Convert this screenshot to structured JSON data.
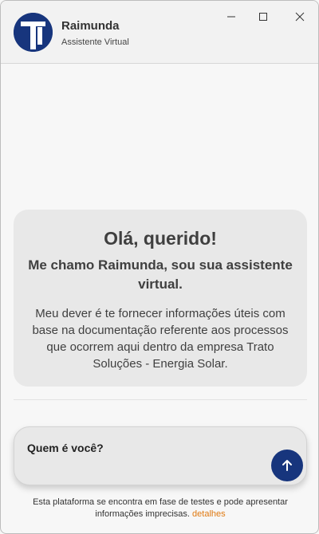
{
  "header": {
    "bot_name": "Raimunda",
    "bot_subtitle": "Assistente Virtual",
    "avatar_icon": "trato-logo-icon",
    "window_controls": [
      "minimize-icon",
      "maximize-icon",
      "close-icon"
    ]
  },
  "welcome": {
    "title": "Olá, querido!",
    "subtitle": "Me chamo Raimunda, sou sua assistente virtual.",
    "body": "Meu dever é te fornecer informações úteis com base na documentação referente aos processos que ocorrem aqui dentro da empresa Trato Soluções - Energia Solar."
  },
  "input": {
    "value": "Quem é você?",
    "send_icon": "arrow-up-icon"
  },
  "footer": {
    "disclaimer": "Esta plataforma se encontra em fase de testes e pode apresentar informações imprecisas.",
    "details_link": "detalhes"
  },
  "colors": {
    "accent": "#17357d",
    "link": "#e07a12",
    "card_bg": "#e8e8e8"
  }
}
